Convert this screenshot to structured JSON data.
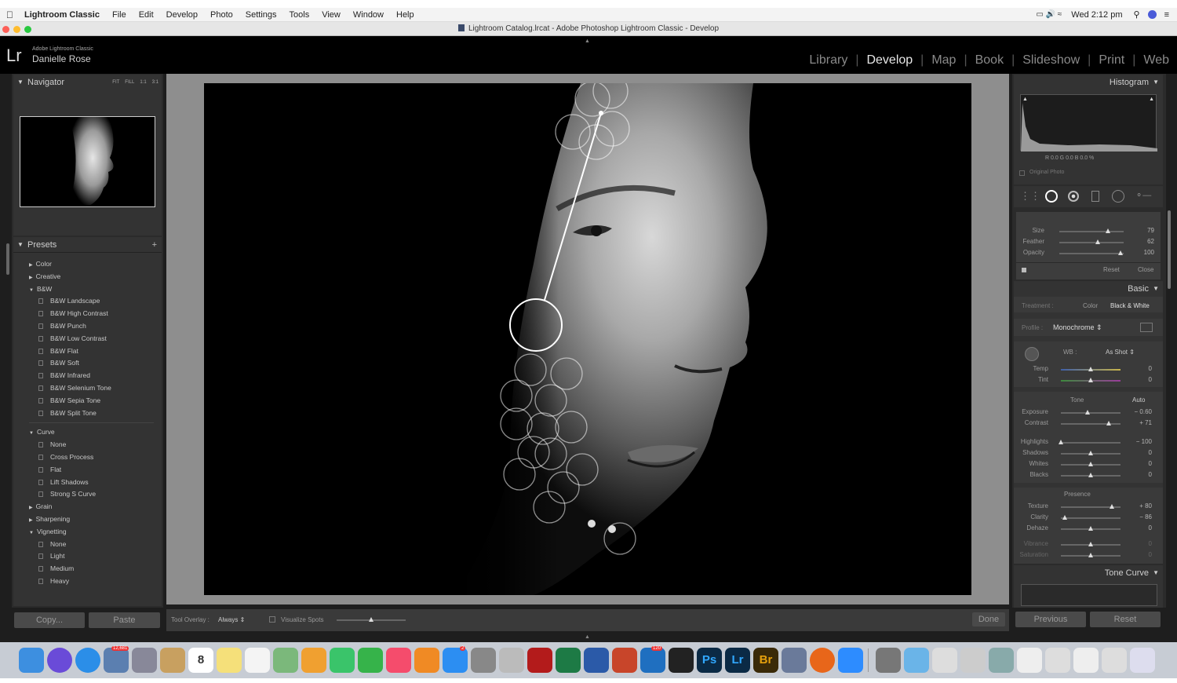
{
  "menubar": {
    "app_name": "Lightroom Classic",
    "items": [
      "File",
      "Edit",
      "Develop",
      "Photo",
      "Settings",
      "Tools",
      "View",
      "Window",
      "Help"
    ],
    "clock": "Wed 2:12 pm"
  },
  "window_title": "Lightroom Catalog.lrcat - Adobe Photoshop Lightroom Classic - Develop",
  "identity": {
    "logo": "Lr",
    "product": "Adobe Lightroom Classic",
    "user": "Danielle Rose"
  },
  "modules": {
    "items": [
      "Library",
      "Develop",
      "Map",
      "Book",
      "Slideshow",
      "Print",
      "Web"
    ],
    "active": "Develop"
  },
  "navigator": {
    "title": "Navigator",
    "zoom_options": [
      "FIT",
      "FILL",
      "1:1",
      "3:1"
    ]
  },
  "presets": {
    "title": "Presets",
    "add_glyph": "+",
    "groups": [
      {
        "name": "Color",
        "open": false,
        "items": []
      },
      {
        "name": "Creative",
        "open": false,
        "items": []
      },
      {
        "name": "B&W",
        "open": true,
        "items": [
          "B&W Landscape",
          "B&W High Contrast",
          "B&W Punch",
          "B&W Low Contrast",
          "B&W Flat",
          "B&W Soft",
          "B&W Infrared",
          "B&W Selenium Tone",
          "B&W Sepia Tone",
          "B&W Split Tone"
        ]
      },
      {
        "name": "Curve",
        "open": true,
        "items": [
          "None",
          "Cross Process",
          "Flat",
          "Lift Shadows",
          "Strong S Curve"
        ]
      },
      {
        "name": "Grain",
        "open": false,
        "items": []
      },
      {
        "name": "Sharpening",
        "open": false,
        "items": []
      },
      {
        "name": "Vignetting",
        "open": true,
        "items": [
          "None",
          "Light",
          "Medium",
          "Heavy"
        ]
      }
    ]
  },
  "left_buttons": {
    "copy": "Copy...",
    "paste": "Paste"
  },
  "toolbar": {
    "tool_overlay_label": "Tool Overlay :",
    "tool_overlay_value": "Always",
    "visualize_spots": "Visualize Spots",
    "done": "Done"
  },
  "histogram": {
    "title": "Histogram",
    "readout": "R  0.0  G  0.0  B  0.0 %",
    "original_photo": "Original Photo"
  },
  "spot_tool": {
    "sliders": [
      {
        "label": "Size",
        "value": "79",
        "pos": 0.75
      },
      {
        "label": "Feather",
        "value": "62",
        "pos": 0.6
      },
      {
        "label": "Opacity",
        "value": "100",
        "pos": 0.95
      }
    ],
    "reset": "Reset",
    "close": "Close"
  },
  "basic": {
    "title": "Basic",
    "treatment_label": "Treatment :",
    "treatment_color": "Color",
    "treatment_bw": "Black & White",
    "profile_label": "Profile :",
    "profile_value": "Monochrome",
    "wb_label": "WB :",
    "wb_value": "As Shot",
    "wb_sliders": [
      {
        "label": "Temp",
        "value": "0",
        "pos": 0.5
      },
      {
        "label": "Tint",
        "value": "0",
        "pos": 0.5
      }
    ],
    "tone_label": "Tone",
    "auto": "Auto",
    "tone_sliders": [
      {
        "label": "Exposure",
        "value": "− 0.60",
        "pos": 0.45
      },
      {
        "label": "Contrast",
        "value": "+ 71",
        "pos": 0.8
      }
    ],
    "tone_sliders2": [
      {
        "label": "Highlights",
        "value": "− 100",
        "pos": 0.0
      },
      {
        "label": "Shadows",
        "value": "0",
        "pos": 0.5
      },
      {
        "label": "Whites",
        "value": "0",
        "pos": 0.5
      },
      {
        "label": "Blacks",
        "value": "0",
        "pos": 0.5
      }
    ],
    "presence_label": "Presence",
    "presence_sliders": [
      {
        "label": "Texture",
        "value": "+ 80",
        "pos": 0.85
      },
      {
        "label": "Clarity",
        "value": "− 86",
        "pos": 0.07
      },
      {
        "label": "Dehaze",
        "value": "0",
        "pos": 0.5
      }
    ],
    "presence_sliders2": [
      {
        "label": "Vibrance",
        "value": "0",
        "pos": 0.5
      },
      {
        "label": "Saturation",
        "value": "0",
        "pos": 0.5
      }
    ]
  },
  "tone_curve": {
    "title": "Tone Curve"
  },
  "right_buttons": {
    "previous": "Previous",
    "reset": "Reset"
  },
  "dock": {
    "mail_badge": "12,681",
    "calendar_day": "8",
    "appstore_badge": "2",
    "outlook_badge": "120",
    "ps": "Ps",
    "lr": "Lr",
    "br": "Br"
  }
}
